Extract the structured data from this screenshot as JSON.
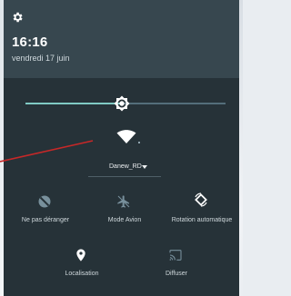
{
  "header": {
    "settings_icon": "gear-icon",
    "time": "16:16",
    "date": "vendredi 17 juin"
  },
  "brightness": {
    "icon": "brightness-icon",
    "level": 0.48
  },
  "network": {
    "icon": "wifi-icon",
    "name": "Danew_RD",
    "dropdown_icon": "chevron-down-icon"
  },
  "tiles": [
    {
      "id": "dnd",
      "label": "Ne pas déranger",
      "icon": "do-not-disturb-icon",
      "active": false
    },
    {
      "id": "airplane",
      "label": "Mode Avion",
      "icon": "airplane-icon",
      "active": false
    },
    {
      "id": "rotation",
      "label": "Rotation automatique",
      "icon": "rotation-icon",
      "active": true
    },
    {
      "id": "location",
      "label": "Localisation",
      "icon": "location-pin-icon",
      "active": true
    },
    {
      "id": "cast",
      "label": "Diffuser",
      "icon": "cast-icon",
      "active": false
    }
  ],
  "colors": {
    "shade_bg": "#263238",
    "header_bg": "#37474f",
    "accent": "#80cbc4",
    "annotation_line": "#c62828"
  }
}
